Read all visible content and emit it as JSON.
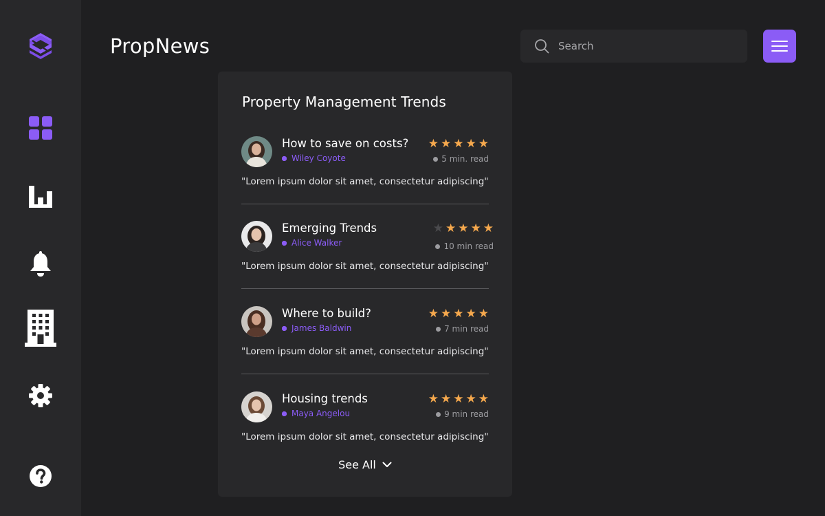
{
  "app": {
    "brand": "PropNews"
  },
  "colors": {
    "accent": "#8b5cf6",
    "star": "#f5a84d",
    "background": "#1f1f21",
    "panel": "#28282a"
  },
  "sidebar": {
    "items": [
      {
        "icon": "logo-icon"
      },
      {
        "icon": "dashboard-icon"
      },
      {
        "icon": "bar-chart-icon"
      },
      {
        "icon": "bell-icon"
      },
      {
        "icon": "building-icon"
      },
      {
        "icon": "gear-icon"
      },
      {
        "icon": "help-icon"
      }
    ]
  },
  "search": {
    "placeholder": "Search",
    "value": ""
  },
  "card": {
    "title": "Property Management Trends",
    "articles": [
      {
        "title": "How to save on costs?",
        "author": "Wiley Coyote",
        "rating": 5,
        "read_time": "5 min. read",
        "excerpt": "\"Lorem ipsum dolor sit amet, consectetur adipiscing\""
      },
      {
        "title": "Emerging Trends",
        "author": "Alice Walker",
        "rating": 4,
        "read_time": "10 min read",
        "excerpt": "\"Lorem ipsum dolor sit amet, consectetur adipiscing\""
      },
      {
        "title": "Where to build?",
        "author": "James Baldwin",
        "rating": 5,
        "read_time": "7 min read",
        "excerpt": "\"Lorem ipsum dolor sit amet, consectetur adipiscing\""
      },
      {
        "title": "Housing trends",
        "author": "Maya Angelou",
        "rating": 5,
        "read_time": "9 min read",
        "excerpt": "\"Lorem ipsum dolor sit amet, consectetur adipiscing\""
      }
    ],
    "see_all": "See All"
  }
}
